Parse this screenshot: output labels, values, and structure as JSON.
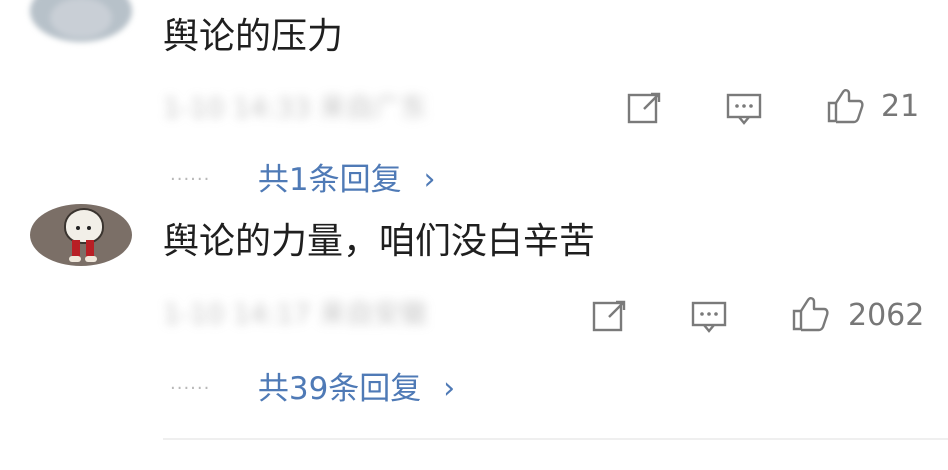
{
  "comments": [
    {
      "text": "舆论的压力",
      "meta": "1-10 14:33 来自广东",
      "like_count": "21",
      "replies": "共1条回复"
    },
    {
      "text": "舆论的力量，咱们没白辛苦",
      "meta": "1-10 14:17 来自安徽",
      "like_count": "2062",
      "replies": "共39条回复"
    }
  ],
  "ui": {
    "dots": "······",
    "chevron": "›"
  },
  "icons": {
    "share": "share-icon",
    "comment": "comment-icon",
    "like": "like-icon"
  },
  "colors": {
    "reply_link": "#4f7ab6",
    "icon": "#7a7a7a"
  }
}
